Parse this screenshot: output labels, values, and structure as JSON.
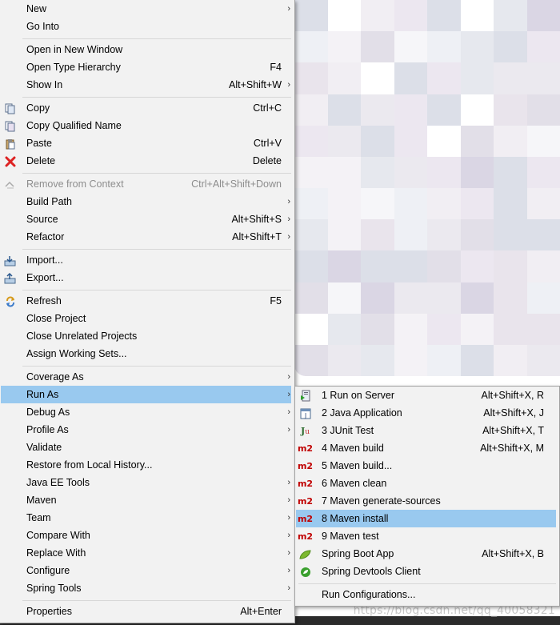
{
  "main_menu": {
    "new": {
      "label": "New"
    },
    "go_into": {
      "label": "Go Into"
    },
    "open_new_window": {
      "label": "Open in New Window"
    },
    "open_type_hierarchy": {
      "label": "Open Type Hierarchy",
      "accel": "F4"
    },
    "show_in": {
      "label": "Show In",
      "accel": "Alt+Shift+W"
    },
    "copy": {
      "label": "Copy",
      "accel": "Ctrl+C"
    },
    "copy_qualified_name": {
      "label": "Copy Qualified Name"
    },
    "paste": {
      "label": "Paste",
      "accel": "Ctrl+V"
    },
    "delete": {
      "label": "Delete",
      "accel": "Delete"
    },
    "remove_from_context": {
      "label": "Remove from Context",
      "accel": "Ctrl+Alt+Shift+Down"
    },
    "build_path": {
      "label": "Build Path"
    },
    "source": {
      "label": "Source",
      "accel": "Alt+Shift+S"
    },
    "refactor": {
      "label": "Refactor",
      "accel": "Alt+Shift+T"
    },
    "import": {
      "label": "Import..."
    },
    "export": {
      "label": "Export..."
    },
    "refresh": {
      "label": "Refresh",
      "accel": "F5"
    },
    "close_project": {
      "label": "Close Project"
    },
    "close_unrelated": {
      "label": "Close Unrelated Projects"
    },
    "assign_working_sets": {
      "label": "Assign Working Sets..."
    },
    "coverage_as": {
      "label": "Coverage As"
    },
    "run_as": {
      "label": "Run As"
    },
    "debug_as": {
      "label": "Debug As"
    },
    "profile_as": {
      "label": "Profile As"
    },
    "validate": {
      "label": "Validate"
    },
    "restore_history": {
      "label": "Restore from Local History..."
    },
    "java_ee_tools": {
      "label": "Java EE Tools"
    },
    "maven": {
      "label": "Maven"
    },
    "team": {
      "label": "Team"
    },
    "compare_with": {
      "label": "Compare With"
    },
    "replace_with": {
      "label": "Replace With"
    },
    "configure": {
      "label": "Configure"
    },
    "spring_tools": {
      "label": "Spring Tools"
    },
    "properties": {
      "label": "Properties",
      "accel": "Alt+Enter"
    }
  },
  "run_as_menu": {
    "run_on_server": {
      "label": "1 Run on Server",
      "accel": "Alt+Shift+X, R"
    },
    "java_application": {
      "label": "2 Java Application",
      "accel": "Alt+Shift+X, J"
    },
    "junit_test": {
      "label": "3 JUnit Test",
      "accel": "Alt+Shift+X, T"
    },
    "maven_build": {
      "label": "4 Maven build",
      "accel": "Alt+Shift+X, M"
    },
    "maven_build_dots": {
      "label": "5 Maven build..."
    },
    "maven_clean": {
      "label": "6 Maven clean"
    },
    "maven_generate_sources": {
      "label": "7 Maven generate-sources"
    },
    "maven_install": {
      "label": "8 Maven install"
    },
    "maven_test": {
      "label": "9 Maven test"
    },
    "spring_boot_app": {
      "label": "Spring Boot App",
      "accel": "Alt+Shift+X, B"
    },
    "spring_devtools": {
      "label": "Spring Devtools Client"
    },
    "run_configurations": {
      "label": "Run Configurations..."
    }
  },
  "icons": {
    "m2_text": "m2",
    "junit_text": "Ju"
  },
  "watermark": "https://blog.csdn.net/qq_40058321",
  "colors": {
    "menu_bg": "#f2f2f2",
    "highlight": "#99c9ef",
    "disabled_text": "#8d8d8d",
    "maven_icon": "#c00000"
  }
}
